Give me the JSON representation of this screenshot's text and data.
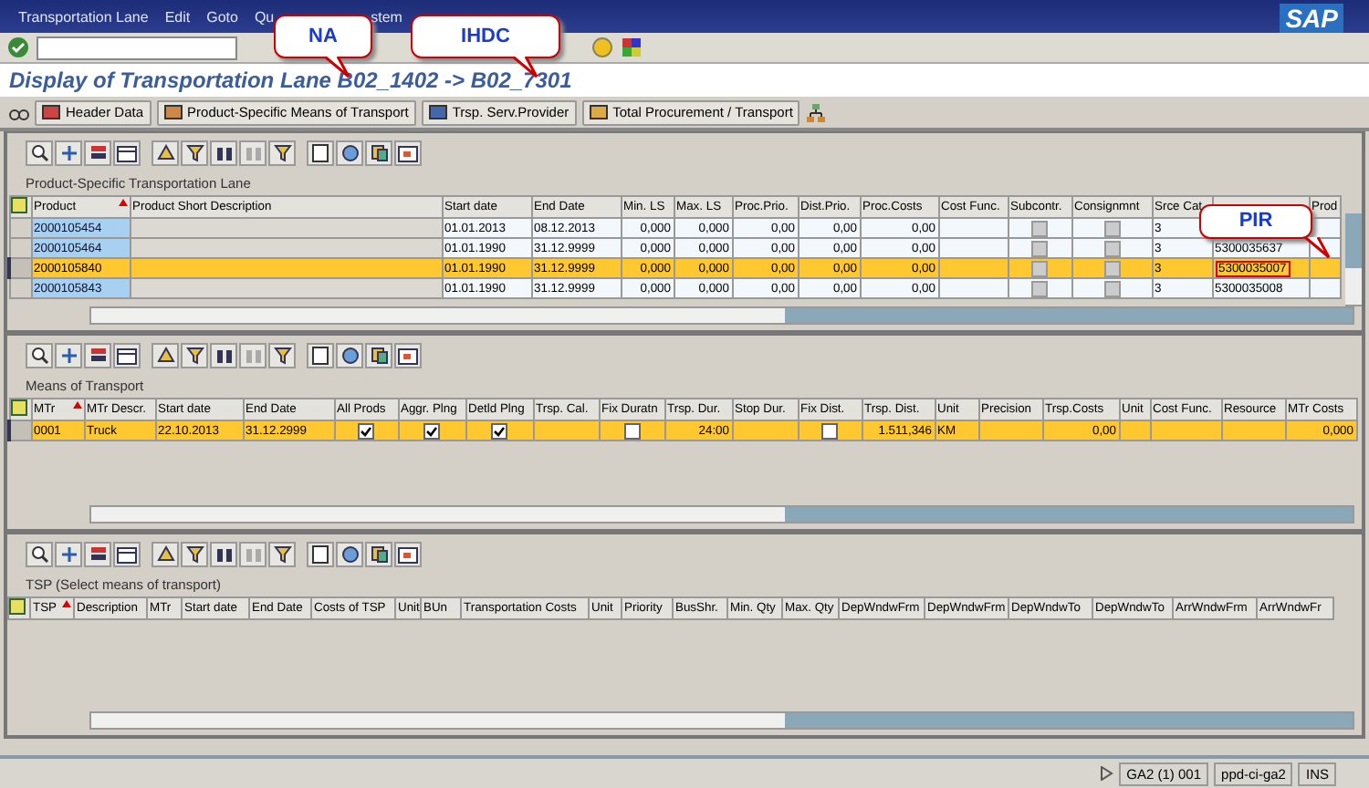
{
  "menu": [
    "Transportation Lane",
    "Edit",
    "Goto",
    "Qu",
    "stem"
  ],
  "logo": "SAP",
  "title": "Display of Transportation Lane B02_1402 -> B02_7301",
  "app_toolbar": [
    "Header Data",
    "Product-Specific Means of Transport",
    "Trsp. Serv.Provider",
    "Total Procurement / Transport"
  ],
  "callouts": [
    {
      "text": "NA"
    },
    {
      "text": "IHDC"
    },
    {
      "text": "PIR"
    }
  ],
  "tables": [
    {
      "label": "Product-Specific Transportation Lane",
      "columns": [
        "Product",
        "Product Short Description",
        "Start date",
        "End Date",
        "Min. LS",
        "Max. LS",
        "Proc.Prio.",
        "Dist.Prio.",
        "Proc.Costs",
        "Cost Func.",
        "Subcontr.",
        "Consignmnt",
        "Srce Cat",
        null,
        "Prod"
      ],
      "rows": [
        {
          "selected": false,
          "cells": [
            "2000105454",
            "",
            "01.01.2013",
            "08.12.2013",
            "0,000",
            "0,000",
            "0,00",
            "0,00",
            "0,00",
            "",
            {
              "checked": false,
              "disabled": true
            },
            {
              "checked": false,
              "disabled": true
            },
            "3",
            null,
            ""
          ]
        },
        {
          "selected": false,
          "cells": [
            "2000105464",
            "",
            "01.01.1990",
            "31.12.9999",
            "0,000",
            "0,000",
            "0,00",
            "0,00",
            "0,00",
            "",
            {
              "checked": false,
              "disabled": true
            },
            {
              "checked": false,
              "disabled": true
            },
            "3",
            "5300035637",
            ""
          ]
        },
        {
          "selected": true,
          "cells": [
            "2000105840",
            "",
            "01.01.1990",
            "31.12.9999",
            "0,000",
            "0,000",
            "0,00",
            "0,00",
            "0,00",
            "",
            {
              "checked": false,
              "disabled": true
            },
            {
              "checked": false,
              "disabled": true
            },
            "3",
            {
              "text": "5300035007",
              "highlighted": true
            },
            ""
          ]
        },
        {
          "selected": false,
          "cells": [
            "2000105843",
            "",
            "01.01.1990",
            "31.12.9999",
            "0,000",
            "0,000",
            "0,00",
            "0,00",
            "0,00",
            "",
            {
              "checked": false,
              "disabled": true
            },
            {
              "checked": false,
              "disabled": true
            },
            "3",
            "5300035008",
            ""
          ]
        }
      ]
    },
    {
      "label": "Means of Transport",
      "columns": [
        "MTr",
        "MTr Descr.",
        "Start date",
        "End Date",
        "All Prods",
        "Aggr. Plng",
        "Detld Plng",
        "Trsp. Cal.",
        "Fix Duratn",
        "Trsp. Dur.",
        "Stop Dur.",
        "Fix Dist.",
        "Trsp. Dist.",
        "Unit",
        "Precision",
        "Trsp.Costs",
        "Unit",
        "Cost Func.",
        "Resource",
        "MTr Costs"
      ],
      "rows": [
        {
          "selected": true,
          "cells": [
            "0001",
            "Truck",
            "22.10.2013",
            "31.12.2999",
            {
              "checked": true,
              "disabled": false
            },
            {
              "checked": true,
              "disabled": false
            },
            {
              "checked": true,
              "disabled": false
            },
            "",
            {
              "checked": false,
              "disabled": false
            },
            "24:00",
            "",
            {
              "checked": false,
              "disabled": false
            },
            "1.511,346",
            "KM",
            "",
            "0,00",
            "",
            "",
            "",
            "0,000"
          ]
        }
      ]
    },
    {
      "label": "TSP (Select means of transport)",
      "columns": [
        "TSP",
        "Description",
        "MTr",
        "Start date",
        "End Date",
        "Costs of TSP",
        "Unit",
        "BUn",
        "Transportation Costs",
        "Unit",
        "Priority",
        "BusShr.",
        "Min. Qty",
        "Max. Qty",
        "DepWndwFrm",
        "DepWndwFrm",
        "DepWndwTo",
        "DepWndwTo",
        "ArrWndwFrm",
        "ArrWndwFr"
      ]
    }
  ],
  "status": {
    "system": "GA2 (1) 001",
    "server": "ppd-ci-ga2",
    "mode": "INS"
  }
}
